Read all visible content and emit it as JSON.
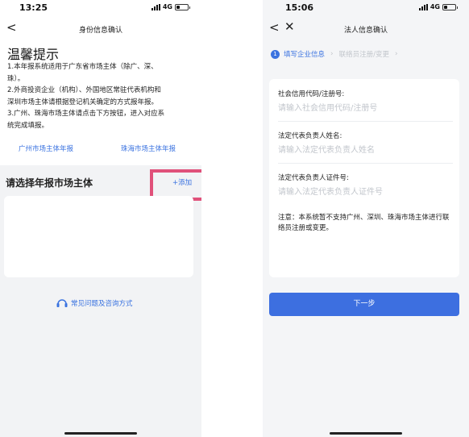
{
  "left": {
    "status": {
      "time": "13:25",
      "network": "4G"
    },
    "nav": {
      "back": "<",
      "title": "身份信息确认"
    },
    "tips": {
      "title": "温馨提示",
      "lines": [
        "1.本年报系统适用于广东省市场主体（除广、深、",
        "珠）。",
        "2.外商投资企业（机构）、外国地区常驻代表机构和",
        "深圳市场主体请根据登记机关确定的方式报年报。",
        "3.广州、珠海市场主体请点击下方按钮，进入对应系",
        "统完成填报。"
      ]
    },
    "links": {
      "guangzhou": "广州市场主体年报",
      "zhuhai": "珠海市场主体年报"
    },
    "section": {
      "title": "请选择年报市场主体",
      "add": "+添加"
    },
    "faq": {
      "label": "常见问题及咨询方式",
      "icon": "headset-icon"
    }
  },
  "right": {
    "status": {
      "time": "15:06",
      "network": "4G"
    },
    "nav": {
      "back": "<",
      "close": "✕",
      "title": "法人信息确认"
    },
    "steps": {
      "num": "1",
      "step1": "填写企业信息",
      "step2": "联络员注册/变更"
    },
    "form": {
      "credit_label": "社会信用代码/注册号:",
      "credit_placeholder": "请输入社会信用代码/注册号",
      "name_label": "法定代表负责人姓名:",
      "name_placeholder": "请输入法定代表负责人姓名",
      "id_label": "法定代表负责人证件号:",
      "id_placeholder": "请输入法定代表负责人证件号",
      "note": "注意：本系统暂不支持广州、深圳、珠海市场主体进行联络员注册或变更。"
    },
    "next_button": "下一步"
  },
  "colors": {
    "accent": "#3b73e0",
    "highlight": "#e0517a",
    "button": "#3d6fe0"
  }
}
